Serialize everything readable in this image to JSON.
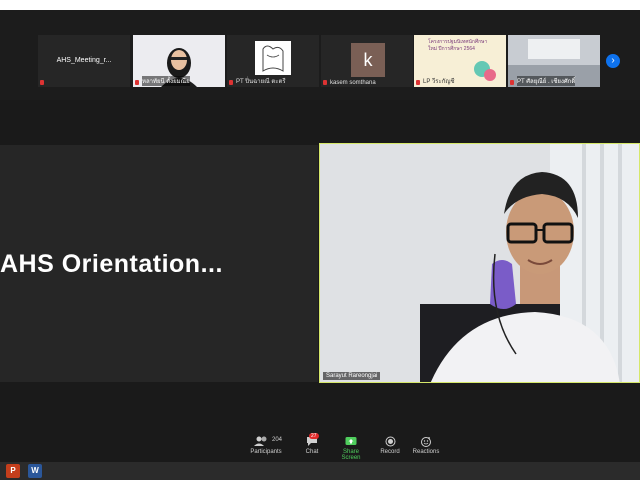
{
  "meeting": {
    "share_title": "AHS  Orientation..."
  },
  "thumbnails": [
    {
      "name": "AHS_Meeting_r..."
    },
    {
      "name": "หลาทัยนี ดั้งยมณีย"
    },
    {
      "name": "PT ปิ่นฉายณี  ตะตรี"
    },
    {
      "name": "kasem somthana",
      "initial": "k"
    },
    {
      "name": "LP วีระกัญชี",
      "slide_title": "โครงการปฐมนิเทศนักศึกษาใหม่ ปีการศึกษา 2564"
    },
    {
      "name": "PT ศัลยุณีย์ . เชียงศักดิ์"
    }
  ],
  "speaker": {
    "name": "Sarayut Rareongjai"
  },
  "toolbar": {
    "participants_count": "204",
    "participants_label": "Participants",
    "chat_badge": "27",
    "chat_label": "Chat",
    "share_label": "Share Screen",
    "record_label": "Record",
    "reactions_label": "Reactions"
  },
  "taskbar": {
    "apps": [
      "P",
      "W"
    ]
  },
  "colors": {
    "accent": "#0e72ed",
    "share_green": "#4fce5d",
    "speaker_border": "#d6e86a",
    "badge_red": "#e02828"
  }
}
